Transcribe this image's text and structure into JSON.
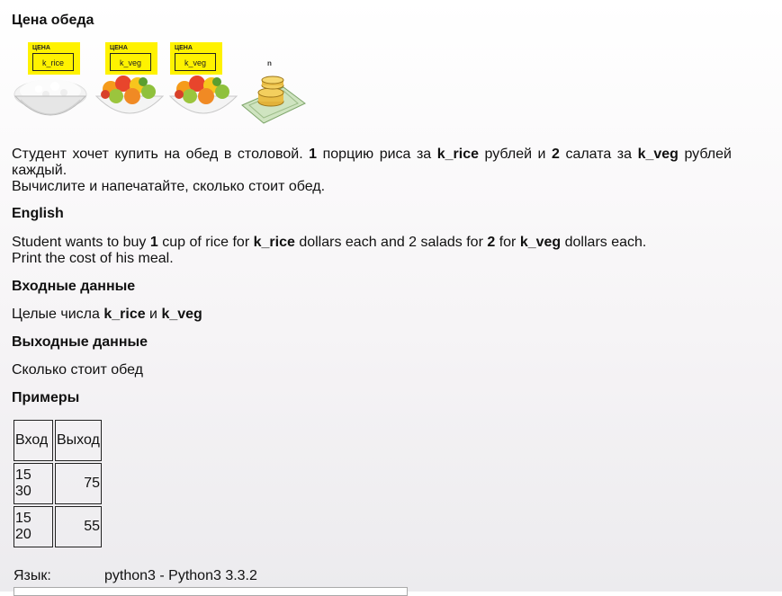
{
  "title": "Цена обеда",
  "images": {
    "tag_caption": "ЦЕНА",
    "tag_rice": "k_rice",
    "tag_veg1": "k_veg",
    "tag_veg2": "k_veg",
    "n_label": "n"
  },
  "ru": {
    "t1": "Студент хочет купить на обед в столовой. ",
    "n1": "1",
    "t2": " порцию риса за ",
    "v1": "k_rice",
    "t3": " рублей и ",
    "n2": "2",
    "t4": " салата за ",
    "v2": "k_veg",
    "t5": " рублей каждый.",
    "line2": "Вычислите и напечатайте, сколько стоит обед."
  },
  "english": {
    "heading": "English",
    "t1": "Student wants to buy ",
    "n1": "1",
    "t2": " cup of rice for ",
    "v1": "k_rice",
    "t3": " dollars each and 2 salads for ",
    "n2": "2",
    "t4": " for ",
    "v2": "k_veg",
    "t5": " dollars each.",
    "line2": "Print the cost of his meal."
  },
  "input_section": {
    "heading": "Входные данные",
    "t1": "Целые числа ",
    "v1": "k_rice",
    "t2": " и ",
    "v2": "k_veg"
  },
  "output_section": {
    "heading": "Выходные данные",
    "text": "Сколько стоит обед"
  },
  "examples": {
    "heading": "Примеры",
    "columns": [
      "Вход",
      "Выход"
    ],
    "rows": [
      [
        "15 30",
        "75"
      ],
      [
        "15 20",
        "55"
      ]
    ]
  },
  "language": {
    "label": "Язык:",
    "value": "python3 - Python3 3.3.2"
  }
}
